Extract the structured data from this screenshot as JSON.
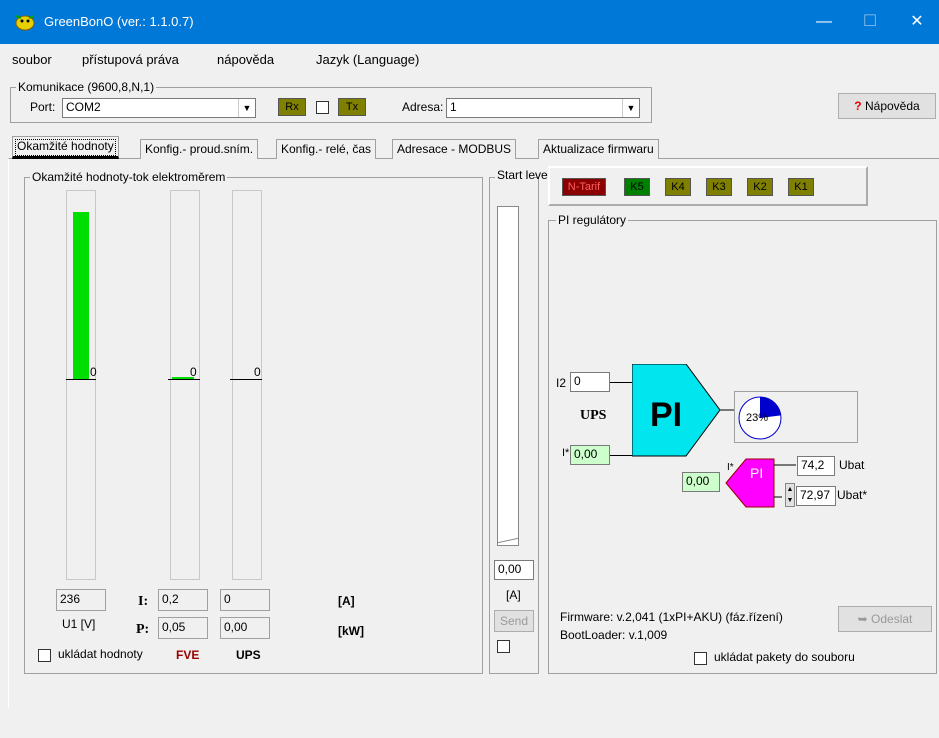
{
  "window": {
    "title": "GreenBonO (ver.: 1.1.0.7)",
    "minimize": "—",
    "maximize": "☐",
    "close": "✕"
  },
  "menu": [
    "soubor",
    "přístupová práva",
    "nápověda",
    "Jazyk (Language)"
  ],
  "comm": {
    "group_label": "Komunikace (9600,8,N,1)",
    "port_label": "Port:",
    "port_value": "COM2",
    "rx": "Rx",
    "tx": "Tx",
    "address_label": "Adresa:",
    "address_value": "1",
    "help_button": "Nápověda"
  },
  "tabs": [
    "Okamžité hodnoty",
    "Konfig.- proud.sním.",
    "Konfig.- relé, čas",
    "Adresace - MODBUS",
    "Aktualizace firmwaru"
  ],
  "meters": {
    "group_label": "Okamžité hodnoty-tok elektroměrem",
    "bars": [
      {
        "value": "0",
        "level": 0.84
      },
      {
        "value": "0",
        "level": 0.0
      },
      {
        "value": "0",
        "level": 0.0
      }
    ],
    "voltage_value": "236",
    "voltage_label": "U1 [V]",
    "i_label": "I:",
    "p_label": "P:",
    "fve_i": "0,2",
    "fve_p": "0,05",
    "ups_i": "0",
    "ups_p": "0,00",
    "unit_a": "[A]",
    "unit_kw": "[kW]",
    "save_label": "ukládat hodnoty",
    "fve_label": "FVE",
    "ups_label": "UPS",
    "bar_color": "#00dd00"
  },
  "start": {
    "label": "Start level",
    "value": "0,00",
    "unit": "[A]",
    "send": "Send"
  },
  "relays": {
    "items": [
      {
        "label": "N-Tarif",
        "color": "#8b0000",
        "text_color": "#ff6060"
      },
      {
        "label": "K5",
        "color": "#008000",
        "text_color": "#000"
      },
      {
        "label": "K4",
        "color": "#808000",
        "text_color": "#000"
      },
      {
        "label": "K3",
        "color": "#808000",
        "text_color": "#000"
      },
      {
        "label": "K2",
        "color": "#808000",
        "text_color": "#000"
      },
      {
        "label": "K1",
        "color": "#808000",
        "text_color": "#000"
      }
    ]
  },
  "pi": {
    "group_label": "PI regulátory",
    "i2_label": "I2",
    "i2_value": "0",
    "ups_label": "UPS",
    "pi_label": "PI",
    "iset_label": "I*",
    "iset_value": "0,00",
    "pie_text": "23%",
    "pie_fraction": 0.23,
    "small_pi_label": "PI",
    "small_in_value": "0,00",
    "small_i_label": "I*",
    "ubat_value": "74,2",
    "ubat_label": "Ubat",
    "ubatset_value": "72,97",
    "ubatset_label": "Ubat*",
    "firmware": "Firmware: v.2,041 (1xPI+AKU) (fáz.řízení)",
    "bootloader": "BootLoader: v.1,009",
    "send_button": "Odeslat",
    "save_packets": "ukládat pakety do souboru",
    "big_color": "#00e5ee",
    "small_color": "#ff00ff"
  }
}
